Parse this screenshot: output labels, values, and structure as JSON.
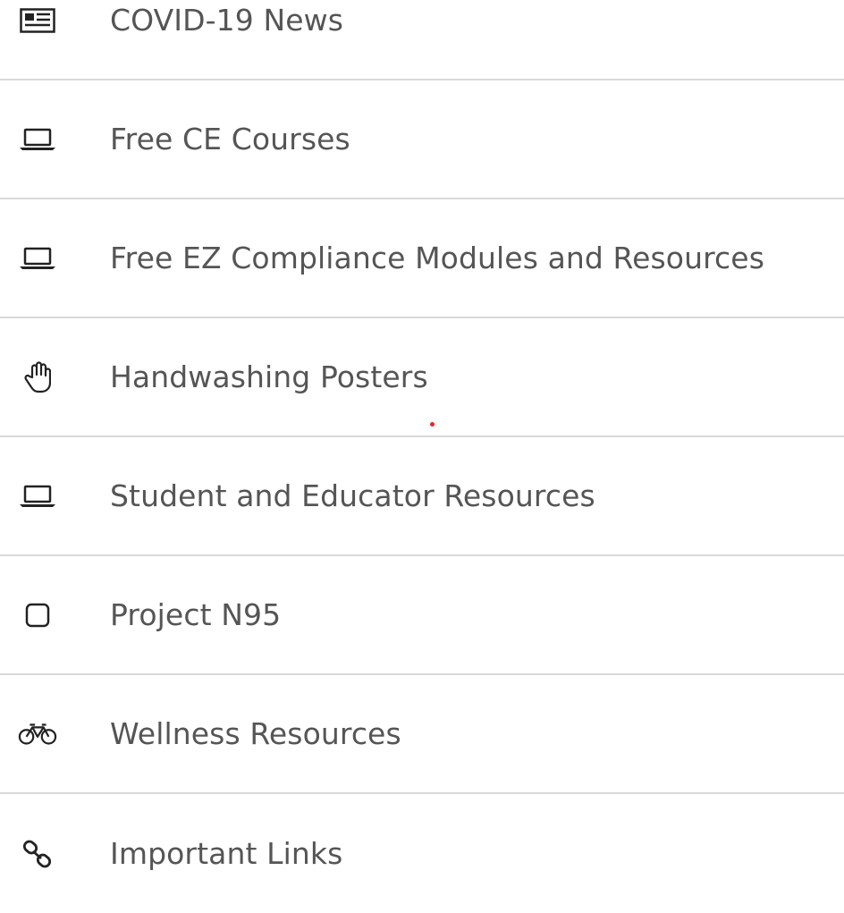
{
  "menu": {
    "items": [
      {
        "label": "COVID-19 News",
        "icon": "newspaper-icon"
      },
      {
        "label": "Free CE Courses",
        "icon": "laptop-icon"
      },
      {
        "label": "Free EZ Compliance Modules and Resources",
        "icon": "laptop-icon"
      },
      {
        "label": "Handwashing Posters",
        "icon": "hand-icon"
      },
      {
        "label": "Student and Educator Resources",
        "icon": "laptop-icon"
      },
      {
        "label": "Project N95",
        "icon": "square-icon"
      },
      {
        "label": "Wellness Resources",
        "icon": "bicycle-icon"
      },
      {
        "label": "Important Links",
        "icon": "link-icon"
      }
    ]
  },
  "colors": {
    "text": "#555555",
    "icon": "#222222",
    "divider": "#d9d9d9",
    "accent_dot": "#e8251f"
  }
}
